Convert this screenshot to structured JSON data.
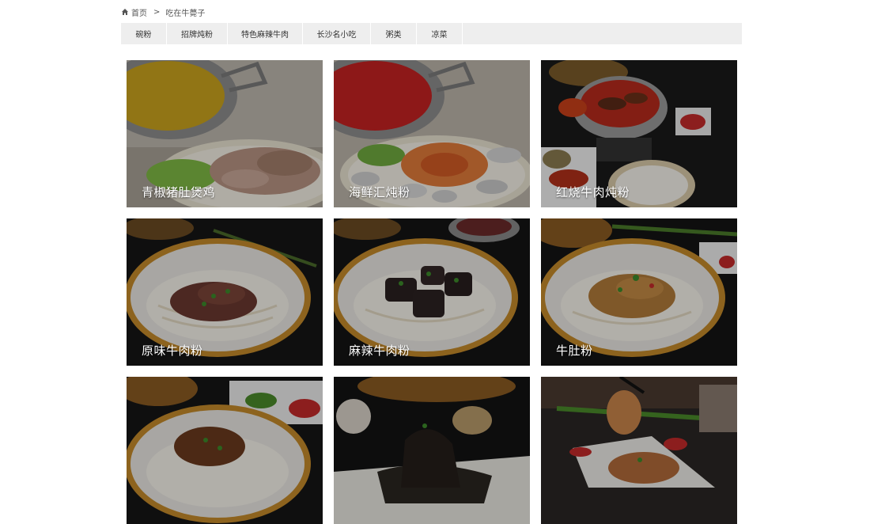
{
  "breadcrumb": {
    "home": "首页",
    "separator": ">",
    "current": "吃在牛薨子"
  },
  "tabs": [
    {
      "label": "碗粉"
    },
    {
      "label": "招牌炖粉"
    },
    {
      "label": "特色麻辣牛肉"
    },
    {
      "label": "长沙名小吃"
    },
    {
      "label": "粥类"
    },
    {
      "label": "凉菜"
    }
  ],
  "dishes": [
    {
      "name": "青椒猪肚煲鸡"
    },
    {
      "name": "海鲜汇炖粉"
    },
    {
      "name": "红烧牛肉炖粉"
    },
    {
      "name": "原味牛肉粉"
    },
    {
      "name": "麻辣牛肉粉"
    },
    {
      "name": "牛肚粉"
    },
    {
      "name": ""
    },
    {
      "name": ""
    },
    {
      "name": ""
    }
  ]
}
